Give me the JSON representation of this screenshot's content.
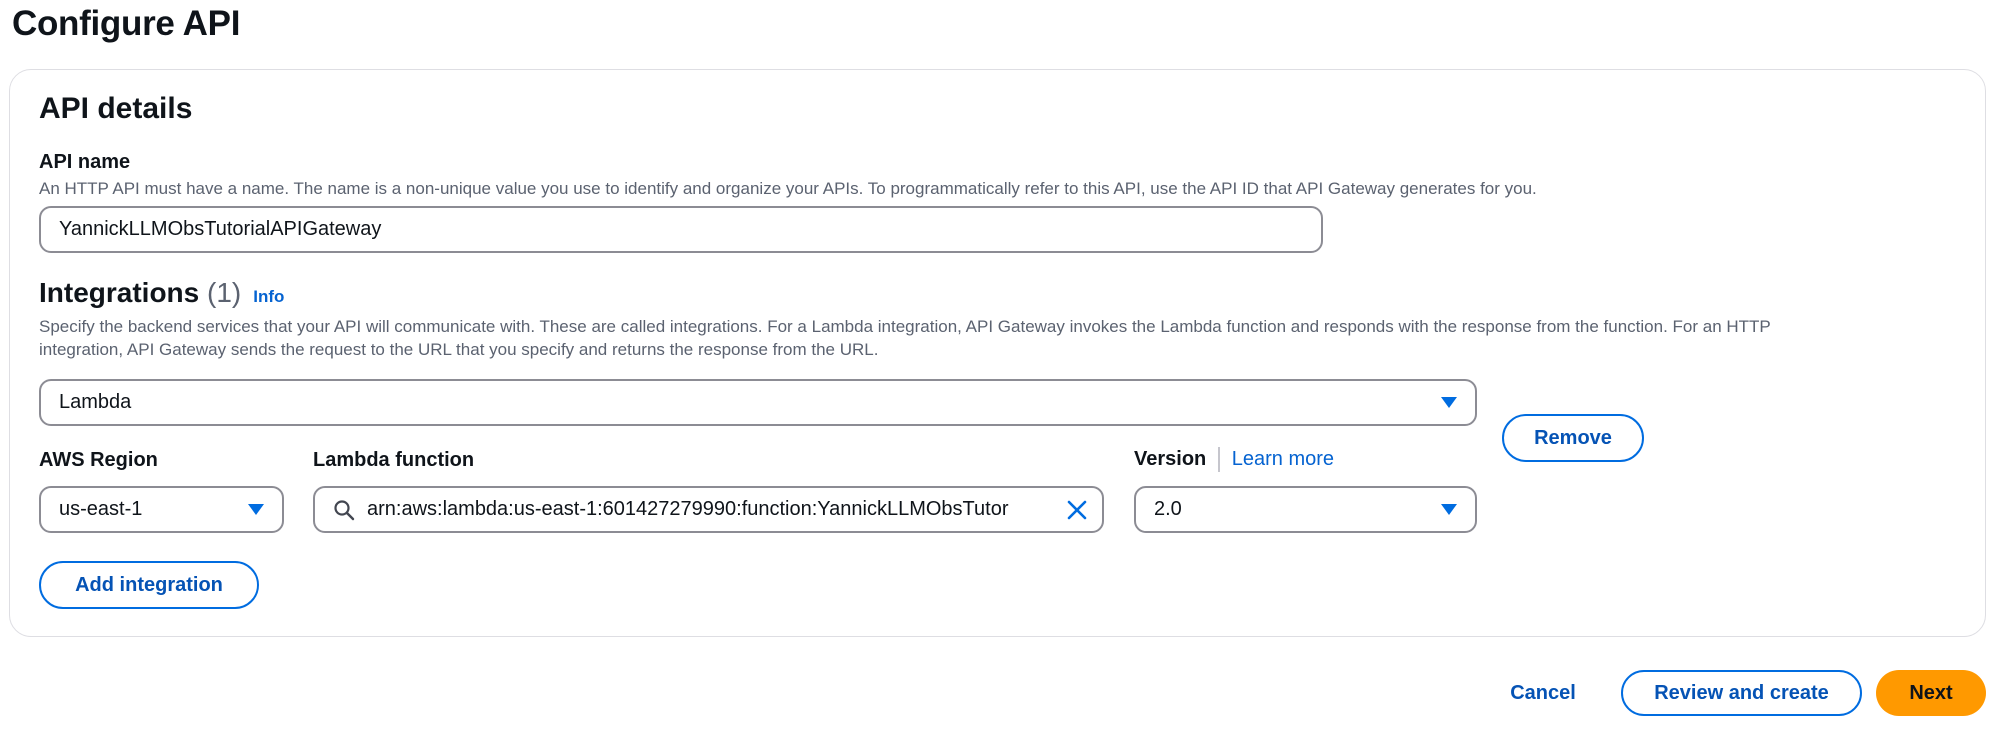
{
  "page": {
    "title": "Configure API"
  },
  "api_details": {
    "section_title": "API details",
    "api_name": {
      "label": "API name",
      "description": "An HTTP API must have a name. The name is a non-unique value you use to identify and organize your APIs. To programmatically refer to this API, use the API ID that API Gateway generates for you.",
      "value": "YannickLLMObsTutorialAPIGateway"
    }
  },
  "integrations": {
    "title": "Integrations",
    "count": "(1)",
    "info_label": "Info",
    "description_line1": "Specify the backend services that your API will communicate with. These are called integrations. For a Lambda integration, API Gateway invokes the Lambda function and responds with the response from the function. For an HTTP",
    "description_line2": "integration, API Gateway sends the request to the URL that you specify and returns the response from the URL.",
    "type_select": {
      "value": "Lambda"
    },
    "remove_label": "Remove",
    "region": {
      "label": "AWS Region",
      "value": "us-east-1"
    },
    "lambda_function": {
      "label": "Lambda function",
      "value": "arn:aws:lambda:us-east-1:601427279990:function:YannickLLMObsTutor"
    },
    "version": {
      "label": "Version",
      "learn_more": "Learn more",
      "value": "2.0"
    },
    "add_integration_label": "Add integration"
  },
  "footer": {
    "cancel_label": "Cancel",
    "review_label": "Review and create",
    "next_label": "Next"
  },
  "colors": {
    "accent": "#006ce0",
    "primary_button": "#ff9900",
    "border": "#8c8c94",
    "muted_text": "#5b6270"
  },
  "icons": [
    "search-icon",
    "clear-icon",
    "caret-down-icon"
  ]
}
